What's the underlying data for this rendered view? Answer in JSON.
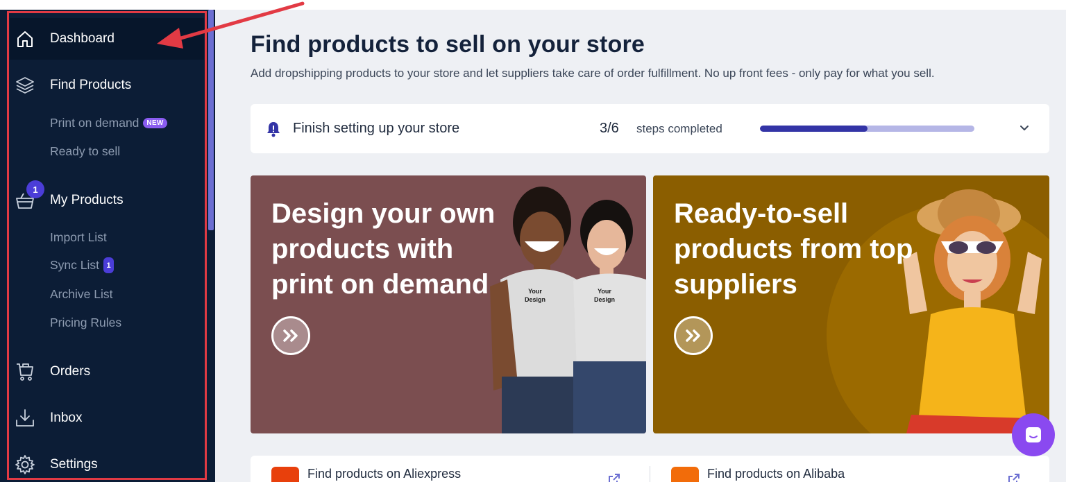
{
  "sidebar": {
    "main_items": [
      {
        "label": "Dashboard",
        "icon": "home-icon"
      },
      {
        "label": "Find Products",
        "icon": "layers-icon"
      },
      {
        "label": "My Products",
        "icon": "basket-icon"
      },
      {
        "label": "Orders",
        "icon": "cart-icon"
      },
      {
        "label": "Inbox",
        "icon": "download-icon"
      },
      {
        "label": "Settings",
        "icon": "gear-icon"
      }
    ],
    "find_products_sub": [
      {
        "label": "Print on demand",
        "badge": "NEW"
      },
      {
        "label": "Ready to sell"
      }
    ],
    "my_products_badge": "1",
    "my_products_sub": [
      {
        "label": "Import List"
      },
      {
        "label": "Sync List",
        "badge": "1"
      },
      {
        "label": "Archive List"
      },
      {
        "label": "Pricing Rules"
      }
    ]
  },
  "main": {
    "title": "Find products to sell on your store",
    "subtitle": "Add dropshipping products to your store and let suppliers take care of order fulfillment. No up front fees - only pay for what you sell.",
    "setup": {
      "title": "Finish setting up your store",
      "count": "3/6",
      "steps_label": "steps completed",
      "progress_fraction": 0.5
    },
    "banners": [
      {
        "headline": "Design your own products with print on demand",
        "bg": "#7b4e50",
        "shirt_text_1": "Your",
        "shirt_text_2": "Design"
      },
      {
        "headline": "Ready-to-sell products from top suppliers",
        "bg": "#8b5e00"
      }
    ],
    "bottom": [
      {
        "label": "Find products on Aliexpress"
      },
      {
        "label": "Find products on Alibaba"
      }
    ]
  },
  "colors": {
    "sidebar_bg": "#0c1d36",
    "accent": "#4b3dd8",
    "annotation_red": "#e23a44",
    "chat_purple": "#8a49f0"
  }
}
